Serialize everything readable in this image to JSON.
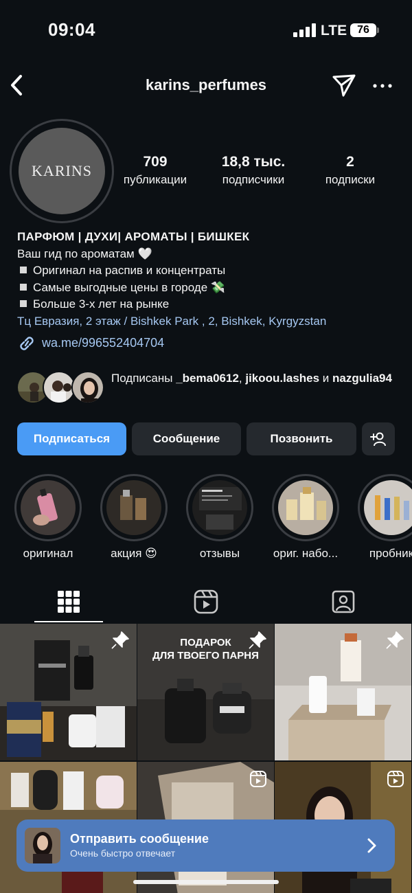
{
  "status": {
    "time": "09:04",
    "network": "LTE",
    "battery": "76"
  },
  "header": {
    "username": "karins_perfumes",
    "back_icon": "chevron-left-icon",
    "send_icon": "paper-plane-icon",
    "more_icon": "ellipsis-icon"
  },
  "profile": {
    "avatar_text": "KARINS",
    "stats": [
      {
        "value": "709",
        "label": "публикации"
      },
      {
        "value": "18,8 тыс.",
        "label": "подписчики"
      },
      {
        "value": "2",
        "label": "подписки"
      }
    ]
  },
  "bio": {
    "title": "ПАРФЮМ | ДУХИ| АРОМАТЫ | БИШКЕК",
    "line1": "Ваш гид по ароматам 🤍",
    "bullets": [
      "Оригинал на распив и концентраты",
      "Самые выгодные цены в городе 💸",
      "Больше 3-х лет на рынке"
    ],
    "address": "Тц Евразия, 2 этаж / Bishkek Park , 2, Bishkek, Kyrgyzstan",
    "link": "wa.me/996552404704"
  },
  "followed_by": {
    "prefix": "Подписаны ",
    "user1": "_bema0612",
    "sep": ", ",
    "user2": "jikoou.lashes",
    "and": " и ",
    "user3": "nazgulia94"
  },
  "actions": {
    "follow": "Подписаться",
    "message": "Сообщение",
    "call": "Позвонить",
    "add_user_icon": "add-user-icon"
  },
  "highlights": [
    "оригинал",
    "акция 😍",
    "отзывы",
    "ориг. набо...",
    "пробник"
  ],
  "tabs": {
    "posts_icon": "grid-icon",
    "reels_icon": "reels-icon",
    "tagged_icon": "tagged-icon"
  },
  "posts": {
    "post2_text_line1": "ПОДАРОК",
    "post2_text_line2": "ДЛЯ ТВОЕГО ПАРНЯ",
    "pinned_icon": "pin-icon",
    "reel_icon": "reels-icon"
  },
  "message_banner": {
    "title": "Отправить сообщение",
    "subtitle": "Очень быстро отвечает"
  },
  "colors": {
    "background": "#0c1014",
    "primary": "#4a9bf5",
    "link": "#a6c8f2",
    "button": "#25292e",
    "banner": "#4f7bbd"
  }
}
